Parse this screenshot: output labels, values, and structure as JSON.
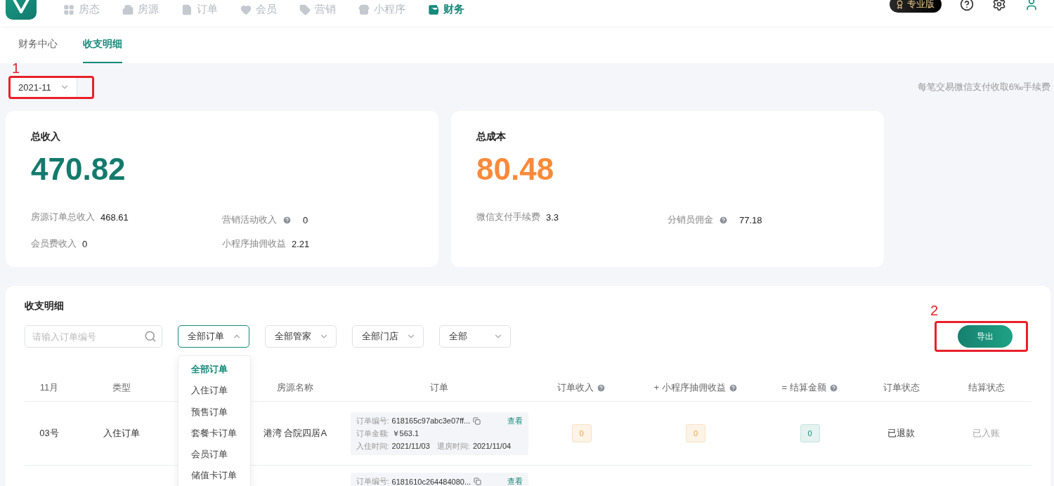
{
  "nav": {
    "items": [
      {
        "label": "房态",
        "selected": false
      },
      {
        "label": "房源",
        "selected": false
      },
      {
        "label": "订单",
        "selected": false
      },
      {
        "label": "会员",
        "selected": false
      },
      {
        "label": "营销",
        "selected": false
      },
      {
        "label": "小程序",
        "selected": false
      },
      {
        "label": "财务",
        "selected": true
      }
    ],
    "badge": "专业版"
  },
  "subtabs": [
    {
      "label": "财务中心",
      "selected": false
    },
    {
      "label": "收支明细",
      "selected": true
    }
  ],
  "month_select": {
    "value": "2021-11"
  },
  "fee_note": "每笔交易微信支付收取6‰手续费",
  "cards": [
    {
      "title": "总收入",
      "amount": "470.82",
      "kind": "income",
      "metrics": [
        {
          "label": "房源订单总收入",
          "value": "468.61",
          "help": false
        },
        {
          "label": "营销活动收入",
          "value": "0",
          "help": true
        },
        {
          "label": "会员费收入",
          "value": "0",
          "help": false
        },
        {
          "label": "小程序抽佣收益",
          "value": "2.21",
          "help": false
        }
      ]
    },
    {
      "title": "总成本",
      "amount": "80.48",
      "kind": "cost",
      "metrics": [
        {
          "label": "微信支付手续费",
          "value": "3.3",
          "help": false
        },
        {
          "label": "分销员佣金",
          "value": "77.18",
          "help": true
        }
      ]
    }
  ],
  "details": {
    "title": "收支明细",
    "search": {
      "placeholder": "请输入订单编号"
    },
    "filters": [
      {
        "value": "全部订单",
        "open": true
      },
      {
        "value": "全部管家",
        "open": false
      },
      {
        "value": "全部门店",
        "open": false
      },
      {
        "value": "全部",
        "open": false
      }
    ],
    "dropdown": [
      {
        "label": "全部订单",
        "selected": true
      },
      {
        "label": "入住订单",
        "selected": false
      },
      {
        "label": "预售订单",
        "selected": false
      },
      {
        "label": "套餐卡订单",
        "selected": false
      },
      {
        "label": "会员订单",
        "selected": false
      },
      {
        "label": "储值卡订单",
        "selected": false
      }
    ],
    "export_button": "导出",
    "table": {
      "columns": [
        {
          "label": "11月",
          "help": false
        },
        {
          "label": "类型",
          "help": false
        },
        {
          "label": "房源名称",
          "help": false
        },
        {
          "label": "订单",
          "help": false
        },
        {
          "label": "订单收入",
          "help": true
        },
        {
          "label": "+ 小程序抽佣收益",
          "help": true
        },
        {
          "label": "= 结算金额",
          "help": true
        },
        {
          "label": "订单状态",
          "help": false
        },
        {
          "label": "结算状态",
          "help": false
        }
      ],
      "rows": [
        {
          "day": "03号",
          "type": "入住订单",
          "room": "港湾 合院四居A",
          "order": {
            "number_label": "订单编号:",
            "number": "618165c97abc3e07ff...",
            "amount_label": "订单金额:",
            "amount": "￥563.1",
            "checkin_label": "入住时间:",
            "checkin": "2021/11/03",
            "checkout_label": "退房时间:",
            "checkout": "2021/11/04",
            "view": "查看"
          },
          "income": "0",
          "commission": "0",
          "settlement": "0",
          "order_status": "已退款",
          "settle_status": "已入账"
        },
        {
          "order": {
            "number_label": "订单编号:",
            "number": "6181610c264484080...",
            "view": "查看"
          }
        }
      ]
    }
  },
  "annotations": [
    "1",
    "2"
  ]
}
